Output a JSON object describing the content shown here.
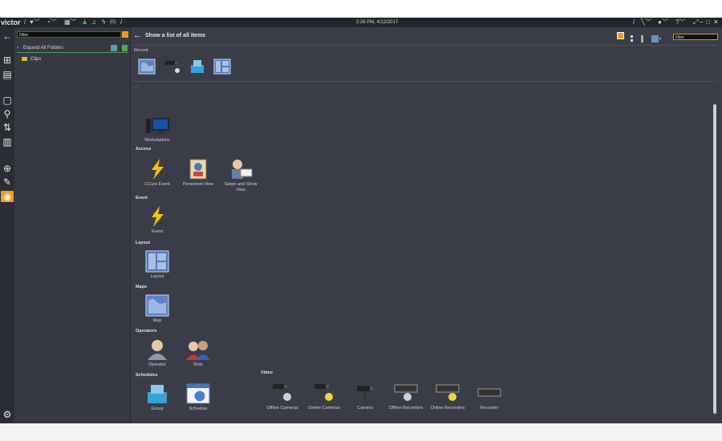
{
  "topbar": {
    "logo": "victor",
    "clock": "2:28 PM, 4/12/2017",
    "alerts_count": "(0)"
  },
  "tree": {
    "filter_placeholder": "Filter",
    "expand_all": "Expand All Folders",
    "clips": "Clips"
  },
  "main": {
    "title": "Show a list of all items",
    "filter_placeholder": "Filter",
    "recent_label": "Recent",
    "dot": "..",
    "sections": {
      "access": "Access",
      "event": "Event",
      "layout": "Layout",
      "maps": "Maps",
      "operators": "Operators",
      "schedules": "Schedules",
      "video": "Video"
    },
    "items": {
      "workstations": "Workstations",
      "ccure_event": "CCure Event",
      "personnel_view": "Personnel View",
      "swipe_show": "Swipe and Show View",
      "event": "Event",
      "layout": "Layout",
      "map": "Map",
      "operator": "Operator",
      "role": "Role",
      "group": "Group",
      "schedule": "Schedule",
      "offline_cameras": "Offline Cameras",
      "online_cameras": "Online Cameras",
      "camera": "Camera",
      "offline_recorders": "Offline Recorders",
      "online_recorders": "Online Recorders",
      "recorder": "Recorder"
    }
  },
  "colors": {
    "accent": "#f39a1e",
    "bg": "#3a3d48",
    "lightning": "#f5c400"
  },
  "icons": [
    "back-arrow-icon",
    "heart-icon",
    "gauge-icon",
    "grid-icon",
    "person-icon",
    "bell-icon",
    "lightning-icon",
    "settings-icon",
    "search-icon",
    "folder-icon",
    "map-icon",
    "camera-icon",
    "layout-icon",
    "group-icon",
    "schedule-icon",
    "monitor-icon",
    "operator-icon",
    "role-icon",
    "recorder-icon",
    "help-icon",
    "user-icon"
  ]
}
